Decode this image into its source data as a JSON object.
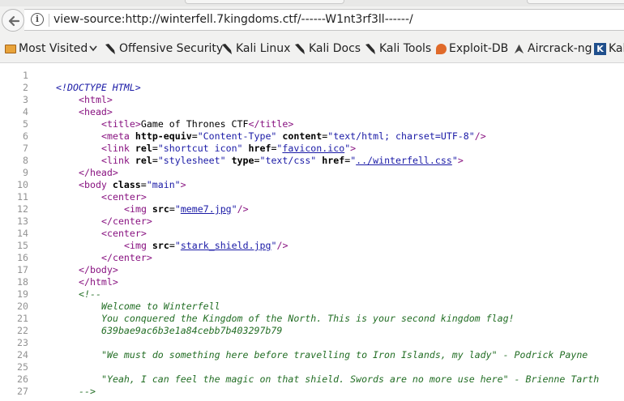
{
  "browser": {
    "url": "view-source:http://winterfell.7kingdoms.ctf/------W1nt3rf3ll------/",
    "bookmarks": [
      {
        "label": "Most Visited",
        "icon": "folder-icon"
      },
      {
        "label": "Offensive Security",
        "icon": "kali-dragon-icon"
      },
      {
        "label": "Kali Linux",
        "icon": "kali-dragon-icon"
      },
      {
        "label": "Kali Docs",
        "icon": "kali-dragon-icon"
      },
      {
        "label": "Kali Tools",
        "icon": "kali-dragon-icon"
      },
      {
        "label": "Exploit-DB",
        "icon": "exploit-db-icon"
      },
      {
        "label": "Aircrack-ng",
        "icon": "aircrack-icon"
      },
      {
        "label": "Kal",
        "icon": "kali-forums-icon"
      }
    ]
  },
  "source": {
    "line_numbers": [
      "1",
      "2",
      "3",
      "4",
      "5",
      "6",
      "7",
      "8",
      "9",
      "10",
      "11",
      "12",
      "13",
      "14",
      "15",
      "16",
      "17",
      "18",
      "19",
      "20",
      "21",
      "22",
      "23",
      "24",
      "25",
      "26",
      "27"
    ],
    "l2": "<!DOCTYPE HTML>",
    "html_open": "<html>",
    "head_open": "<head>",
    "title_open": "<title>",
    "title_text": "Game of Thrones CTF",
    "title_close": "</title>",
    "meta_open": "<meta ",
    "meta_attr1": "http-equiv",
    "meta_val1": "\"Content-Type\"",
    "meta_attr2": "content",
    "meta_val2": "\"text/html; charset=UTF-8\"",
    "selfclose": "/>",
    "link_open": "<link ",
    "link1_attr": "rel",
    "link1_val": "\"shortcut icon\"",
    "href_attr": "href",
    "link1_href": "favicon.ico",
    "close_gt": ">",
    "link2_attr1": "rel",
    "link2_val1": "\"stylesheet\"",
    "link2_attr2": "type",
    "link2_val2": "\"text/css\"",
    "link2_href": "../winterfell.css",
    "head_close": "</head>",
    "body_open": "<body ",
    "body_attr": "class",
    "body_val": "\"main\"",
    "center_open": "<center>",
    "img_open": "<img ",
    "src_attr": "src",
    "img1_src": "meme7.jpg",
    "center_close": "</center>",
    "img2_src": "stark_shield.jpg",
    "body_close": "</body>",
    "html_close": "</html>",
    "c19": "<!--",
    "c20": "Welcome to Winterfell",
    "c21": "You conquered the Kingdom of the North. This is your second kingdom flag!",
    "c22": "639bae9ac6b3e1a84cebb7b403297b79",
    "c24": "\"We must do something here before travelling to Iron Islands, my lady\" - Podrick Payne",
    "c26": "\"Yeah, I can feel the magic on that shield. Swords are no more use here\" - Brienne Tarth",
    "c27": "-->"
  }
}
